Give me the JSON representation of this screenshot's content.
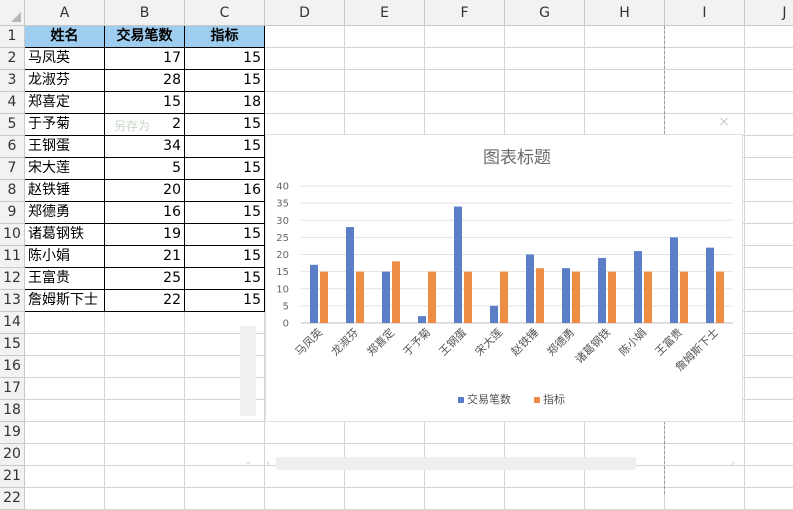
{
  "columns": [
    "A",
    "B",
    "C",
    "D",
    "E",
    "F",
    "G",
    "H",
    "I",
    "J"
  ],
  "rows": [
    "1",
    "2",
    "3",
    "4",
    "5",
    "6",
    "7",
    "8",
    "9",
    "10",
    "11",
    "12",
    "13",
    "14",
    "15",
    "16",
    "17",
    "18",
    "19",
    "20",
    "21",
    "22"
  ],
  "table": {
    "headers": [
      "姓名",
      "交易笔数",
      "指标"
    ],
    "rows": [
      [
        "马凤英",
        "17",
        "15"
      ],
      [
        "龙淑芬",
        "28",
        "15"
      ],
      [
        "郑喜定",
        "15",
        "18"
      ],
      [
        "于予菊",
        "2",
        "15"
      ],
      [
        "王钢蛋",
        "34",
        "15"
      ],
      [
        "宋大莲",
        "5",
        "15"
      ],
      [
        "赵铁锤",
        "20",
        "16"
      ],
      [
        "郑德勇",
        "16",
        "15"
      ],
      [
        "诸葛钢铁",
        "19",
        "15"
      ],
      [
        "陈小娟",
        "21",
        "15"
      ],
      [
        "王富贵",
        "25",
        "15"
      ],
      [
        "詹姆斯下士",
        "22",
        "15"
      ]
    ]
  },
  "ghost": {
    "save_hint": "另存为",
    "close": "×"
  },
  "colors": {
    "header_fill": "#9fcdf0",
    "series1": "#5b7fc6",
    "series2": "#ed8c45"
  },
  "chart_data": {
    "type": "bar",
    "title": "图表标题",
    "categories": [
      "马凤英",
      "龙淑芬",
      "郑喜定",
      "于予菊",
      "王钢蛋",
      "宋大莲",
      "赵铁锤",
      "郑德勇",
      "诸葛钢铁",
      "陈小娟",
      "王富贵",
      "詹姆斯下士"
    ],
    "series": [
      {
        "name": "交易笔数",
        "values": [
          17,
          28,
          15,
          2,
          34,
          5,
          20,
          16,
          19,
          21,
          25,
          22
        ],
        "color": "#5b7fc6"
      },
      {
        "name": "指标",
        "values": [
          15,
          15,
          18,
          15,
          15,
          15,
          16,
          15,
          15,
          15,
          15,
          15
        ],
        "color": "#ed8c45"
      }
    ],
    "ylim": [
      0,
      40
    ],
    "yticks": [
      "0",
      "5",
      "10",
      "15",
      "20",
      "25",
      "30",
      "35",
      "40"
    ],
    "grid": true,
    "legend": "bottom"
  }
}
